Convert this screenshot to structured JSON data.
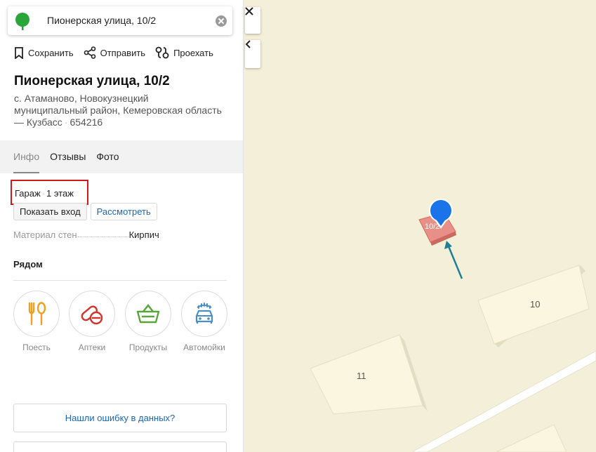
{
  "search": {
    "value": "Пионерская улица, 10/2"
  },
  "actions": {
    "save": "Сохранить",
    "share": "Отправить",
    "route": "Проехать"
  },
  "place": {
    "title": "Пионерская улица, 10/2",
    "address_line1": "с. Атаманово, Новокузнецкий",
    "address_line2": "муниципальный район, Кемеровская область",
    "address_line3": "— Кузбасс",
    "postal_code": "654216"
  },
  "tabs": [
    "Инфо",
    "Отзывы",
    "Фото"
  ],
  "info": {
    "kind": "Гараж",
    "floors": "1 этаж",
    "show_entrance": "Показать вход",
    "view": "Рассмотреть",
    "attr_label": "Материал стен",
    "attr_value": "Кирпич"
  },
  "nearby": {
    "title": "Рядом",
    "items": [
      {
        "label": "Поесть",
        "icon": "fork-spoon-icon",
        "color": "#f0a020"
      },
      {
        "label": "Аптеки",
        "icon": "pill-icon",
        "color": "#d0342c"
      },
      {
        "label": "Продукты",
        "icon": "basket-icon",
        "color": "#5aa53a"
      },
      {
        "label": "Автомойки",
        "icon": "car-wash-icon",
        "color": "#4a8ec8"
      }
    ]
  },
  "report_error": "Нашли ошибку в данных?",
  "map": {
    "labels": {
      "b_10_2": "10/2",
      "b_10": "10",
      "b_11": "11"
    },
    "colors": {
      "marker": "#1a73e8",
      "selected_building": "#e89088",
      "arrow": "#1f7f96",
      "building": "#fbf6df"
    }
  }
}
